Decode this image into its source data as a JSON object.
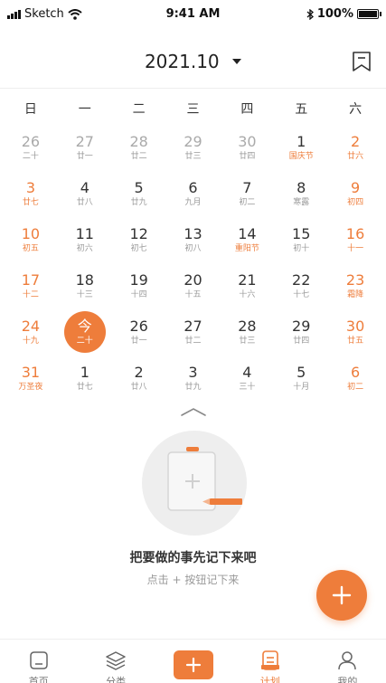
{
  "status_bar": {
    "carrier": "Sketch",
    "time": "9:41 AM",
    "battery": "100%"
  },
  "header": {
    "month": "2021.10"
  },
  "weekdays": [
    "日",
    "一",
    "二",
    "三",
    "四",
    "五",
    "六"
  ],
  "calendar": {
    "weeks": [
      [
        {
          "n": "26",
          "s": "二十"
        },
        {
          "n": "27",
          "s": "廿一"
        },
        {
          "n": "28",
          "s": "廿二"
        },
        {
          "n": "29",
          "s": "廿三"
        },
        {
          "n": "30",
          "s": "廿四"
        },
        {
          "n": "1",
          "s": "国庆节"
        },
        {
          "n": "2",
          "s": "廿六"
        }
      ],
      [
        {
          "n": "3",
          "s": "廿七"
        },
        {
          "n": "4",
          "s": "廿八"
        },
        {
          "n": "5",
          "s": "廿九"
        },
        {
          "n": "6",
          "s": "九月"
        },
        {
          "n": "7",
          "s": "初二"
        },
        {
          "n": "8",
          "s": "寒露"
        },
        {
          "n": "9",
          "s": "初四"
        }
      ],
      [
        {
          "n": "10",
          "s": "初五"
        },
        {
          "n": "11",
          "s": "初六"
        },
        {
          "n": "12",
          "s": "初七"
        },
        {
          "n": "13",
          "s": "初八"
        },
        {
          "n": "14",
          "s": "重阳节"
        },
        {
          "n": "15",
          "s": "初十"
        },
        {
          "n": "16",
          "s": "十一"
        }
      ],
      [
        {
          "n": "17",
          "s": "十二"
        },
        {
          "n": "18",
          "s": "十三"
        },
        {
          "n": "19",
          "s": "十四"
        },
        {
          "n": "20",
          "s": "十五"
        },
        {
          "n": "21",
          "s": "十六"
        },
        {
          "n": "22",
          "s": "十七"
        },
        {
          "n": "23",
          "s": "霜降"
        }
      ],
      [
        {
          "n": "24",
          "s": "十九"
        },
        {
          "n": "今",
          "s": "二十"
        },
        {
          "n": "26",
          "s": "廿一"
        },
        {
          "n": "27",
          "s": "廿二"
        },
        {
          "n": "28",
          "s": "廿三"
        },
        {
          "n": "29",
          "s": "廿四"
        },
        {
          "n": "30",
          "s": "廿五"
        }
      ],
      [
        {
          "n": "31",
          "s": "万圣夜"
        },
        {
          "n": "1",
          "s": "廿七"
        },
        {
          "n": "2",
          "s": "廿八"
        },
        {
          "n": "3",
          "s": "廿九"
        },
        {
          "n": "4",
          "s": "三十"
        },
        {
          "n": "5",
          "s": "十月"
        },
        {
          "n": "6",
          "s": "初二"
        }
      ]
    ]
  },
  "empty_state": {
    "title": "把要做的事先记下来吧",
    "hint": "点击 + 按钮记下来"
  },
  "tabs": [
    {
      "label": "首页",
      "icon": "home-icon"
    },
    {
      "label": "分类",
      "icon": "layers-icon"
    },
    {
      "label": "",
      "icon": "add-icon"
    },
    {
      "label": "计划",
      "icon": "plan-icon"
    },
    {
      "label": "我的",
      "icon": "user-icon"
    }
  ],
  "colors": {
    "accent": "#ee7d3b",
    "muted_text": "#999999"
  }
}
